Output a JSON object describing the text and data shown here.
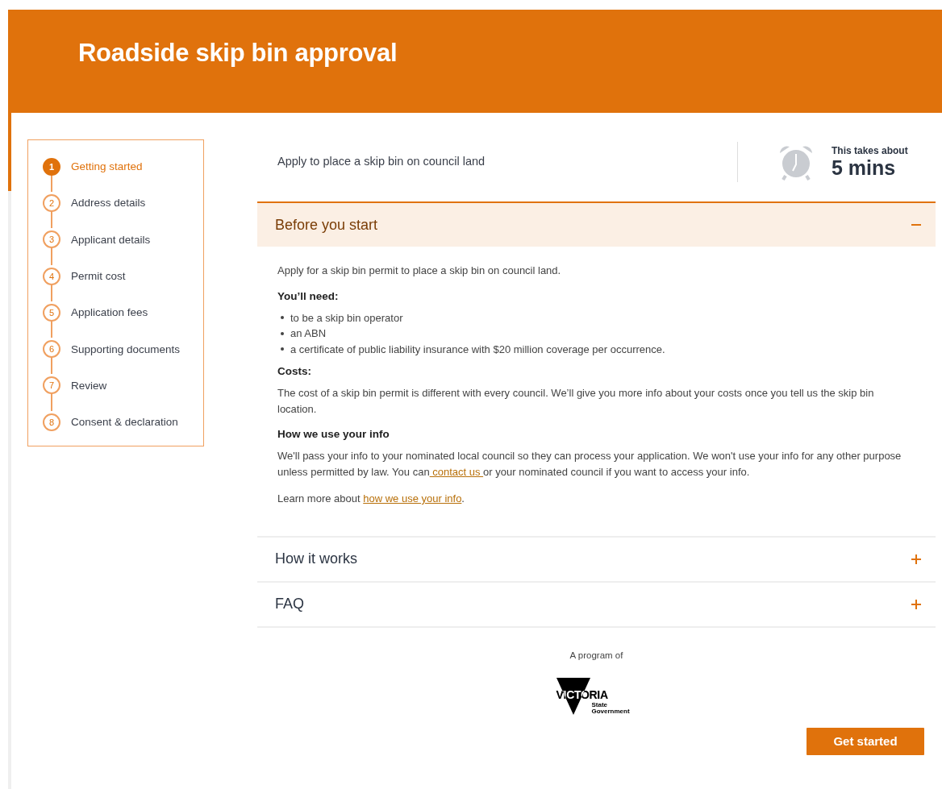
{
  "header": {
    "title": "Roadside skip bin approval"
  },
  "steps": [
    {
      "number": "1",
      "label": "Getting started",
      "selected": true
    },
    {
      "number": "2",
      "label": "Address details",
      "selected": false
    },
    {
      "number": "3",
      "label": "Applicant details",
      "selected": false
    },
    {
      "number": "4",
      "label": "Permit cost",
      "selected": false
    },
    {
      "number": "5",
      "label": "Application fees",
      "selected": false
    },
    {
      "number": "6",
      "label": "Supporting documents",
      "selected": false
    },
    {
      "number": "7",
      "label": "Review",
      "selected": false
    },
    {
      "number": "8",
      "label": "Consent & declaration",
      "selected": false
    }
  ],
  "intro": {
    "text": "Apply to place a skip bin on council land",
    "duration_label": "This takes about",
    "duration": "5 mins"
  },
  "accordions": [
    {
      "title": "Before you start",
      "expanded": true,
      "body": [
        {
          "kind": "paragraph",
          "parts": [
            {
              "text": "Apply for a skip bin permit to place a skip bin on council land."
            }
          ]
        },
        {
          "kind": "heading",
          "text": "You’ll need:"
        },
        {
          "kind": "list",
          "items": [
            "to be a skip bin operator",
            "an ABN",
            "a certificate of public liability insurance with $20 million coverage per occurrence."
          ]
        },
        {
          "kind": "heading",
          "text": "Costs:"
        },
        {
          "kind": "paragraph",
          "parts": [
            {
              "text": "The cost of a skip bin permit is different with every council. We’ll give you more info about your costs once you tell us the skip bin location."
            }
          ]
        },
        {
          "kind": "heading",
          "text": "How we use your info"
        },
        {
          "kind": "paragraph",
          "parts": [
            {
              "text": "We'll pass your info to your nominated local council so they can process your application. We won't use your info for any other purpose unless permitted by law. You can"
            },
            {
              "text": " contact us ",
              "link": true
            },
            {
              "text": "or your nominated council if you want to access your info."
            }
          ]
        },
        {
          "kind": "paragraph",
          "parts": [
            {
              "text": "Learn more about "
            },
            {
              "text": "how we use your info",
              "link": true
            },
            {
              "text": "."
            }
          ]
        }
      ]
    },
    {
      "title": "How it works",
      "expanded": false
    },
    {
      "title": "FAQ",
      "expanded": false
    }
  ],
  "footer": {
    "program_label": "A program of",
    "logo_word": "VICTORIA",
    "logo_sub": [
      "State",
      "Government"
    ]
  },
  "actions": {
    "primary": "Get started"
  }
}
